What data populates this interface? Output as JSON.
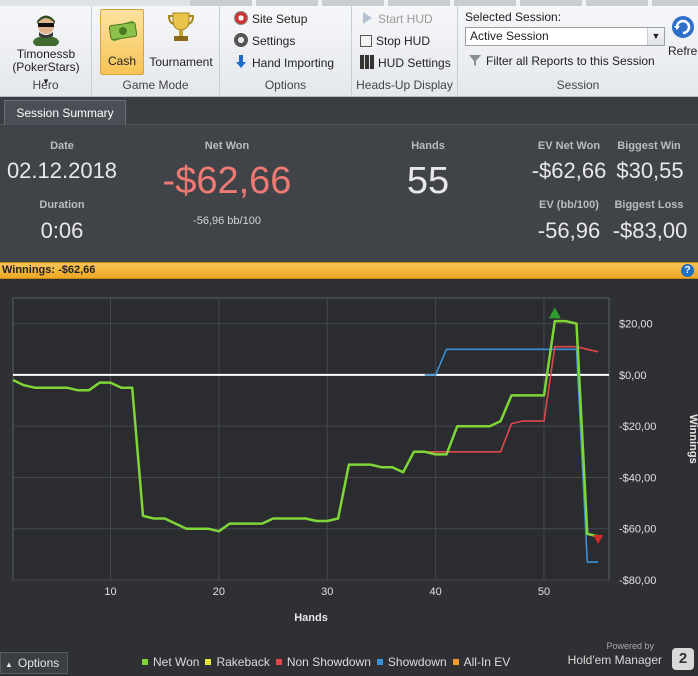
{
  "ribbon": {
    "hero": {
      "name": "Timonessb",
      "site": "(PokerStars)",
      "group_label": "Hero"
    },
    "game_mode": {
      "cash_label": "Cash",
      "tournament_label": "Tournament",
      "group_label": "Game Mode"
    },
    "options": {
      "site_setup_label": "Site Setup",
      "settings_label": "Settings",
      "hand_importing_label": "Hand Importing",
      "group_label": "Options"
    },
    "hud": {
      "start_hud_label": "Start HUD",
      "stop_hud_label": "Stop HUD",
      "hud_settings_label": "HUD Settings",
      "group_label": "Heads-Up Display"
    },
    "session": {
      "selected_label": "Selected Session:",
      "selected_value": "Active Session",
      "filter_label": "Filter all Reports to this Session",
      "refresh_label": "Refres",
      "group_label": "Session"
    }
  },
  "tabs": {
    "session_summary": "Session Summary"
  },
  "summary": {
    "date_label": "Date",
    "date_value": "02.12.2018",
    "duration_label": "Duration",
    "duration_value": "0:06",
    "net_won_label": "Net Won",
    "net_won_value": "-$62,66",
    "net_won_bb": "-56,96 bb/100",
    "hands_label": "Hands",
    "hands_value": "55",
    "ev_net_won_label": "EV Net Won",
    "ev_net_won_value": "-$62,66",
    "ev_bb_label": "EV (bb/100)",
    "ev_bb_value": "-56,96",
    "biggest_win_label": "Biggest Win",
    "biggest_win_value": "$30,55",
    "biggest_loss_label": "Biggest Loss",
    "biggest_loss_value": "-$83,00",
    "net_won_color": "#f07a73"
  },
  "winnings_bar": {
    "label": "Winnings: -$62,66",
    "help_icon": "?"
  },
  "footer": {
    "options_label": "Options",
    "powered_by": "Powered by",
    "brand": "Hold'em Manager",
    "brand_logo": "2"
  },
  "chart_data": {
    "type": "line",
    "xlabel": "Hands",
    "ylabel": "Winnings",
    "xlim": [
      1,
      56
    ],
    "ylim": [
      -80,
      30
    ],
    "xticks": [
      10,
      20,
      30,
      40,
      50
    ],
    "yticks": [
      20,
      0,
      -20,
      -40,
      -60,
      -80
    ],
    "ytick_labels": [
      "$20,00",
      "$0,00",
      "-$20,00",
      "-$40,00",
      "-$60,00",
      "-$80,00"
    ],
    "grid": true,
    "legend_position": "bottom",
    "series": [
      {
        "name": "Net Won",
        "color": "#7fd637",
        "x": [
          1,
          2,
          3,
          4,
          5,
          6,
          7,
          8,
          9,
          10,
          11,
          12,
          13,
          14,
          15,
          16,
          17,
          18,
          19,
          20,
          21,
          22,
          23,
          24,
          25,
          26,
          27,
          28,
          29,
          30,
          31,
          32,
          33,
          34,
          35,
          36,
          37,
          38,
          39,
          40,
          41,
          42,
          43,
          44,
          45,
          46,
          47,
          48,
          49,
          50,
          51,
          52,
          53,
          54,
          55
        ],
        "y": [
          -2,
          -4,
          -5,
          -5,
          -5,
          -5,
          -6,
          -6,
          -3,
          -3,
          -5,
          -5,
          -55,
          -56,
          -56,
          -58,
          -60,
          -60,
          -60,
          -61,
          -58,
          -58,
          -58,
          -58,
          -56,
          -56,
          -56,
          -56,
          -57,
          -57,
          -56,
          -35,
          -35,
          -35,
          -36,
          -36,
          -38,
          -30,
          -30,
          -31,
          -31,
          -20,
          -20,
          -20,
          -20,
          -18,
          -8,
          -8,
          -8,
          -8,
          21,
          21,
          20,
          -62,
          -63
        ]
      },
      {
        "name": "Rakeback",
        "color": "#e6e13a",
        "x": [],
        "y": []
      },
      {
        "name": "Non Showdown",
        "color": "#e0474b",
        "x": [
          38,
          39,
          40,
          41,
          42,
          43,
          44,
          45,
          46,
          47,
          48,
          49,
          50,
          51,
          52,
          53,
          54,
          55
        ],
        "y": [
          -30,
          -30,
          -30,
          -30,
          -30,
          -30,
          -30,
          -30,
          -30,
          -19,
          -18,
          -18,
          -18,
          11,
          11,
          11,
          10,
          9
        ]
      },
      {
        "name": "Showdown",
        "color": "#3a8fd6",
        "x": [
          39,
          40,
          41,
          42,
          43,
          44,
          45,
          46,
          47,
          48,
          49,
          50,
          51,
          52,
          53,
          54,
          55
        ],
        "y": [
          0,
          0,
          10,
          10,
          10,
          10,
          10,
          10,
          10,
          10,
          10,
          10,
          10,
          10,
          10,
          -73,
          -73
        ]
      },
      {
        "name": "All-In EV",
        "color": "#f09a2a",
        "x": [],
        "y": []
      }
    ],
    "zero_line_color": "#ffffff",
    "markers": [
      {
        "type": "max",
        "color": "#2e9c2e",
        "x": 51,
        "y": 24
      },
      {
        "type": "min",
        "color": "#d42a2a",
        "x": 55,
        "y": -64
      }
    ]
  }
}
